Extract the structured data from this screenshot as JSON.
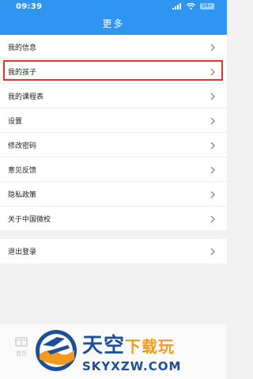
{
  "status_bar": {
    "time": "09:39",
    "battery": "24+"
  },
  "nav": {
    "title": "更多"
  },
  "menu": {
    "items": [
      {
        "label": "我的信息"
      },
      {
        "label": "我的孩子"
      },
      {
        "label": "我的课程表"
      },
      {
        "label": "设置"
      },
      {
        "label": "修改密码"
      },
      {
        "label": "意见反馈"
      },
      {
        "label": "隐私政策"
      },
      {
        "label": "关于中国微校"
      }
    ]
  },
  "logout": {
    "label": "退出登录"
  },
  "tabbar": {
    "home_label": "首页"
  },
  "watermark": {
    "title_main": "天空",
    "title_accent": "下载玩",
    "url": "SKYXZW.COM"
  },
  "colors": {
    "header_blue": "#2e96f1",
    "highlight_red": "#e8312a",
    "watermark_blue": "#1b4f9c",
    "watermark_orange": "#f39a1e"
  }
}
